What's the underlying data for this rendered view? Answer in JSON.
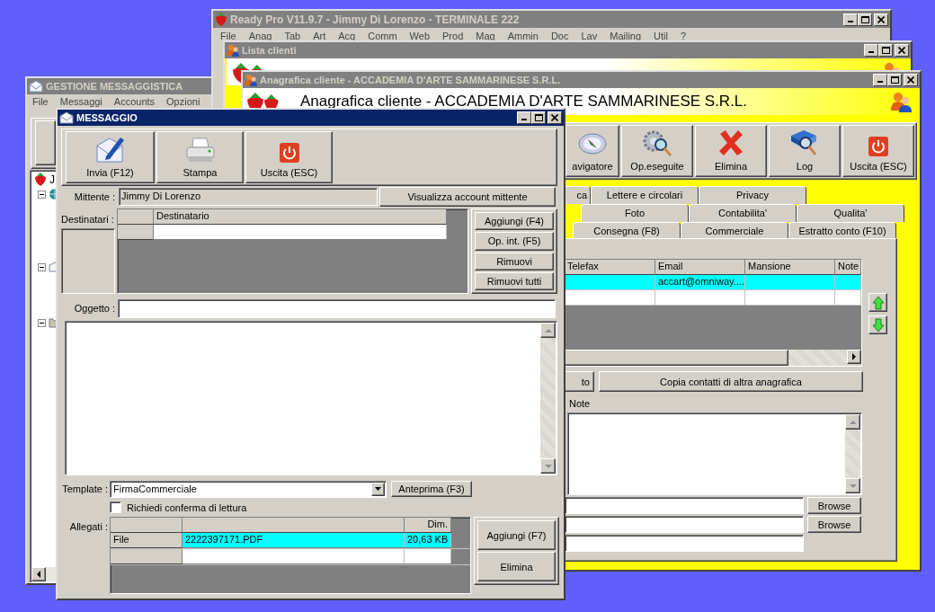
{
  "gestione_window": {
    "title": "GESTIONE MESSAGGISTICA",
    "active": false,
    "menu": [
      "File",
      "Messaggi",
      "Accounts",
      "Opzioni"
    ],
    "tree": [
      {
        "label": "J",
        "children": [
          {
            "expanded": true
          },
          {
            "expanded": true
          },
          {
            "expanded": true
          }
        ]
      }
    ]
  },
  "ready_pro_window": {
    "title": "Ready Pro V11.9.7 - Jimmy Di Lorenzo - TERMINALE 222",
    "active": false,
    "menu": [
      "File",
      "Anag",
      "Tab",
      "Art",
      "Acq",
      "Comm",
      "Web",
      "Prod",
      "Mag",
      "Ammin",
      "Doc",
      "Lav",
      "Mailing",
      "Util",
      "?"
    ]
  },
  "lista_clienti_window": {
    "title": "Lista clienti",
    "active": false
  },
  "anagrafica_window": {
    "title": "Anagrafica cliente - ACCADEMIA D'ARTE SAMMARINESE S.R.L.",
    "active": false,
    "header": "Anagrafica cliente - ACCADEMIA D'ARTE SAMMARINESE S.R.L.",
    "toolbar": [
      {
        "label": "avigatore"
      },
      {
        "label": "Op.eseguite"
      },
      {
        "label": "Elimina"
      },
      {
        "label": "Log"
      },
      {
        "label": "Uscita (ESC)"
      }
    ],
    "tab_rows": [
      [
        {
          "label": "ca",
          "selected": false
        },
        {
          "label": "Lettere e circolari",
          "selected": false
        },
        {
          "label": "Privacy",
          "selected": false
        }
      ],
      [
        {
          "label": "Foto",
          "selected": false
        },
        {
          "label": "Contabilita'",
          "selected": false
        },
        {
          "label": "Qualita'",
          "selected": false
        }
      ],
      [
        {
          "label": "Consegna (F8)",
          "selected": false
        },
        {
          "label": "Commerciale",
          "selected": false
        },
        {
          "label": "Estratto conto (F10)",
          "selected": false
        }
      ]
    ],
    "contacts_table": {
      "columns": [
        "Telefax",
        "Email",
        "Mansione",
        "Note"
      ],
      "rows": [
        {
          "selected": true,
          "email": "accart@omniway...."
        },
        {
          "selected": false
        }
      ]
    },
    "buttons": [
      "to",
      "Copia contatti di altra anagrafica"
    ],
    "note_label": "Note",
    "browse_buttons": [
      "Browse",
      "Browse"
    ]
  },
  "messaggio_window": {
    "title": "MESSAGGIO",
    "active": true,
    "toolbar": [
      {
        "label": "Invia (F12)"
      },
      {
        "label": "Stampa"
      },
      {
        "label": "Uscita (ESC)"
      }
    ],
    "sender": {
      "label": "Mittente :",
      "value": "Jimmy Di Lorenzo",
      "button": "Visualizza account mittente"
    },
    "recipients": {
      "label": "Destinatari :",
      "column": "Destinatario",
      "buttons": [
        "Aggiungi (F4)",
        "Op. int. (F5)",
        "Rimuovi",
        "Rimuovi tutti"
      ]
    },
    "subject": {
      "label": "Oggetto :"
    },
    "template": {
      "label": "Template :",
      "value": "FirmaCommerciale",
      "button": "Anteprima (F3)"
    },
    "read_receipt": {
      "label": "Richiedi conferma di lettura",
      "checked": false
    },
    "attachments": {
      "label": "Allegati :",
      "size_column": "Dim.",
      "rows": [
        {
          "selected": true,
          "type": "File",
          "name": "2222397171.PDF",
          "size": "20,63 KB"
        },
        {
          "selected": false
        }
      ],
      "buttons": [
        "Aggiungi (F7)",
        "Elimina"
      ]
    }
  }
}
